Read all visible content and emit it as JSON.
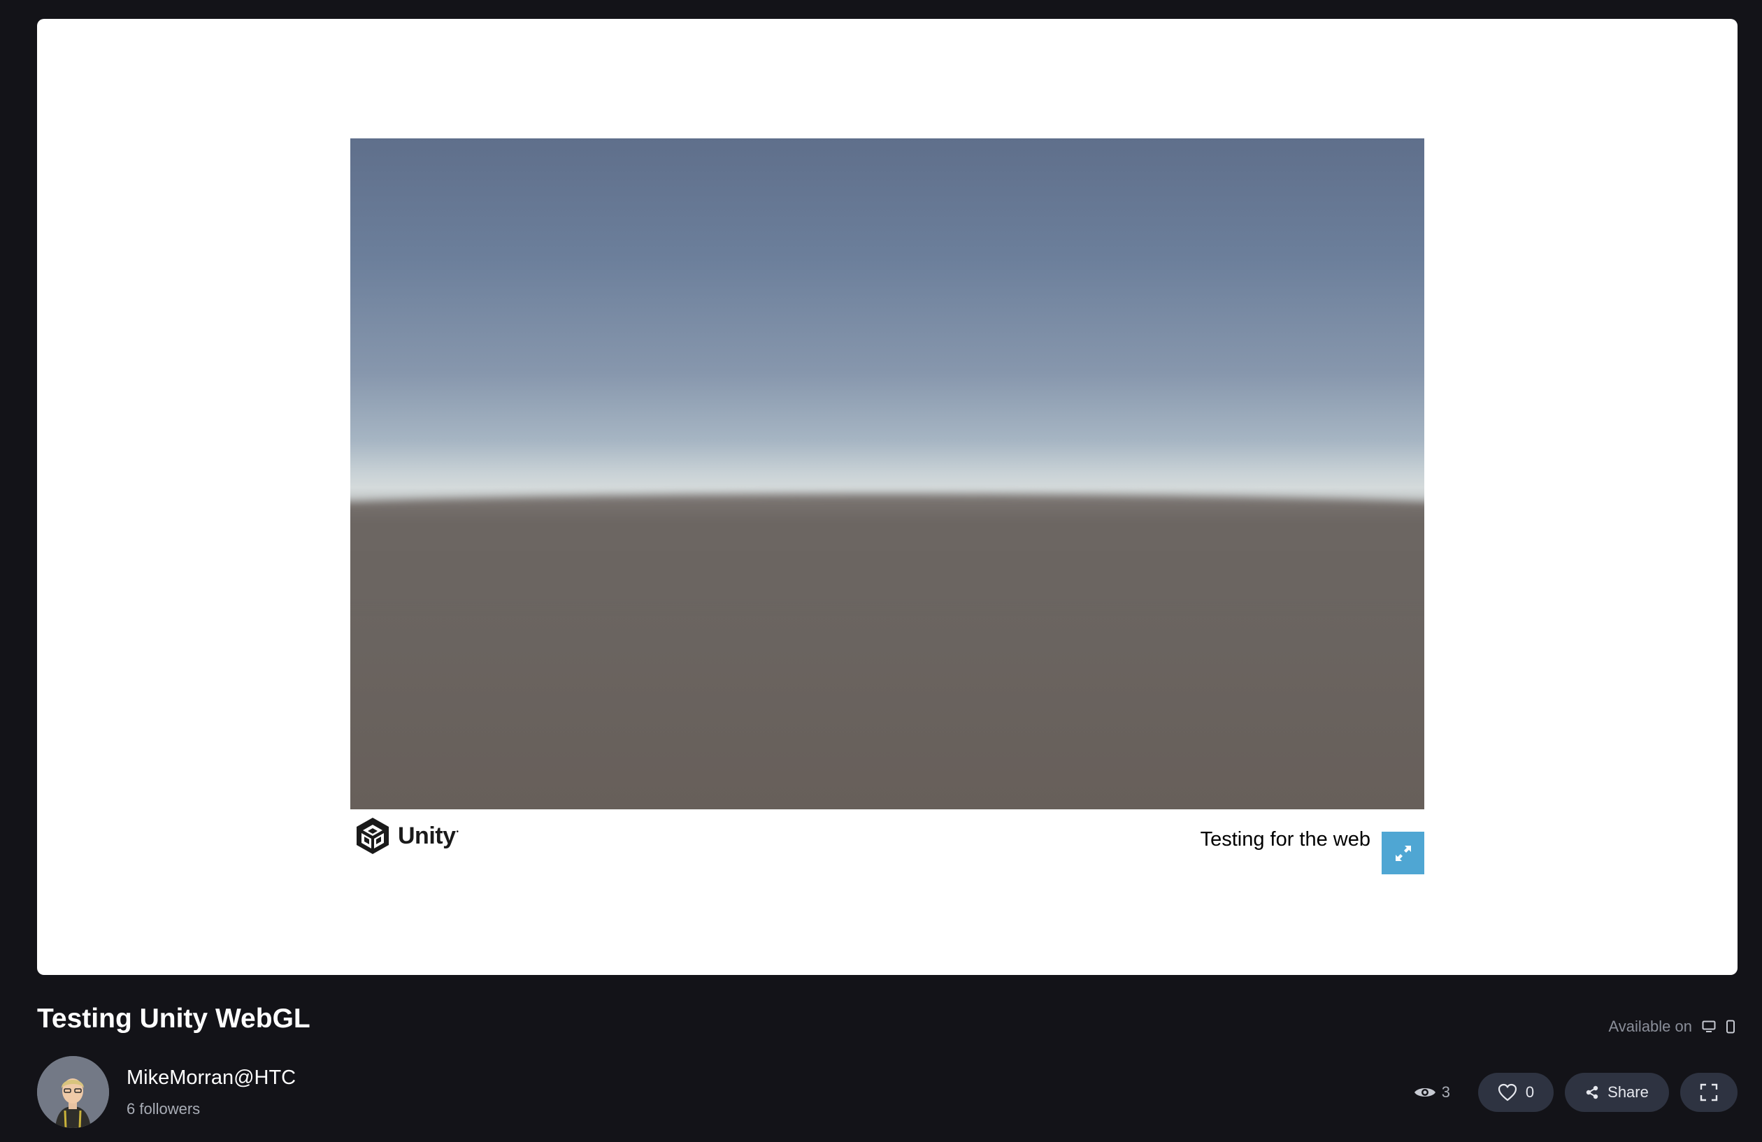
{
  "embed": {
    "build_title": "Testing for the web",
    "unity_logo_text": "Unity",
    "accent_color": "#4fa6d3"
  },
  "project": {
    "title": "Testing Unity WebGL",
    "available_on_label": "Available on",
    "platforms": [
      "desktop-icon",
      "mobile-icon"
    ]
  },
  "author": {
    "name": "MikeMorran@HTC",
    "followers": "6 followers"
  },
  "stats": {
    "views": "3",
    "likes": "0",
    "share_label": "Share"
  },
  "colors": {
    "page_background": "#131318",
    "pill_background": "#2e3341"
  }
}
